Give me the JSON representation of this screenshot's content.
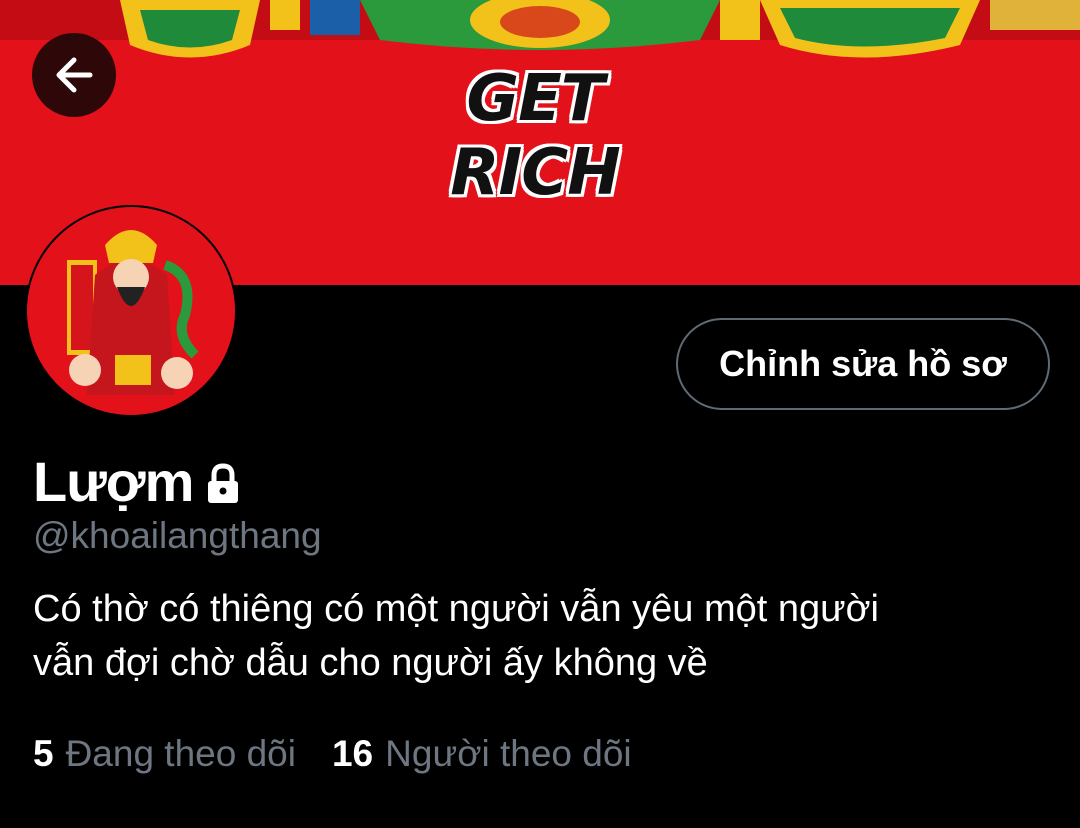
{
  "header": {
    "banner_text": "GET RICH",
    "back_icon": "arrow-left-icon",
    "banner_color": "#e3111a"
  },
  "profile": {
    "display_name": "Lượm",
    "protected_icon": "lock-icon",
    "handle": "@khoailangthang",
    "bio_line1": "Có thờ có thiêng có một người vẫn yêu một người",
    "bio_line2": "vẫn đợi chờ dẫu cho người ấy không về",
    "edit_button_label": "Chỉnh sửa hồ sơ"
  },
  "stats": {
    "following_count": "5",
    "following_label": "Đang theo dõi",
    "followers_count": "16",
    "followers_label": "Người theo dõi"
  },
  "colors": {
    "background": "#000000",
    "muted_text": "#6e7781",
    "button_border": "#5e6a74"
  }
}
